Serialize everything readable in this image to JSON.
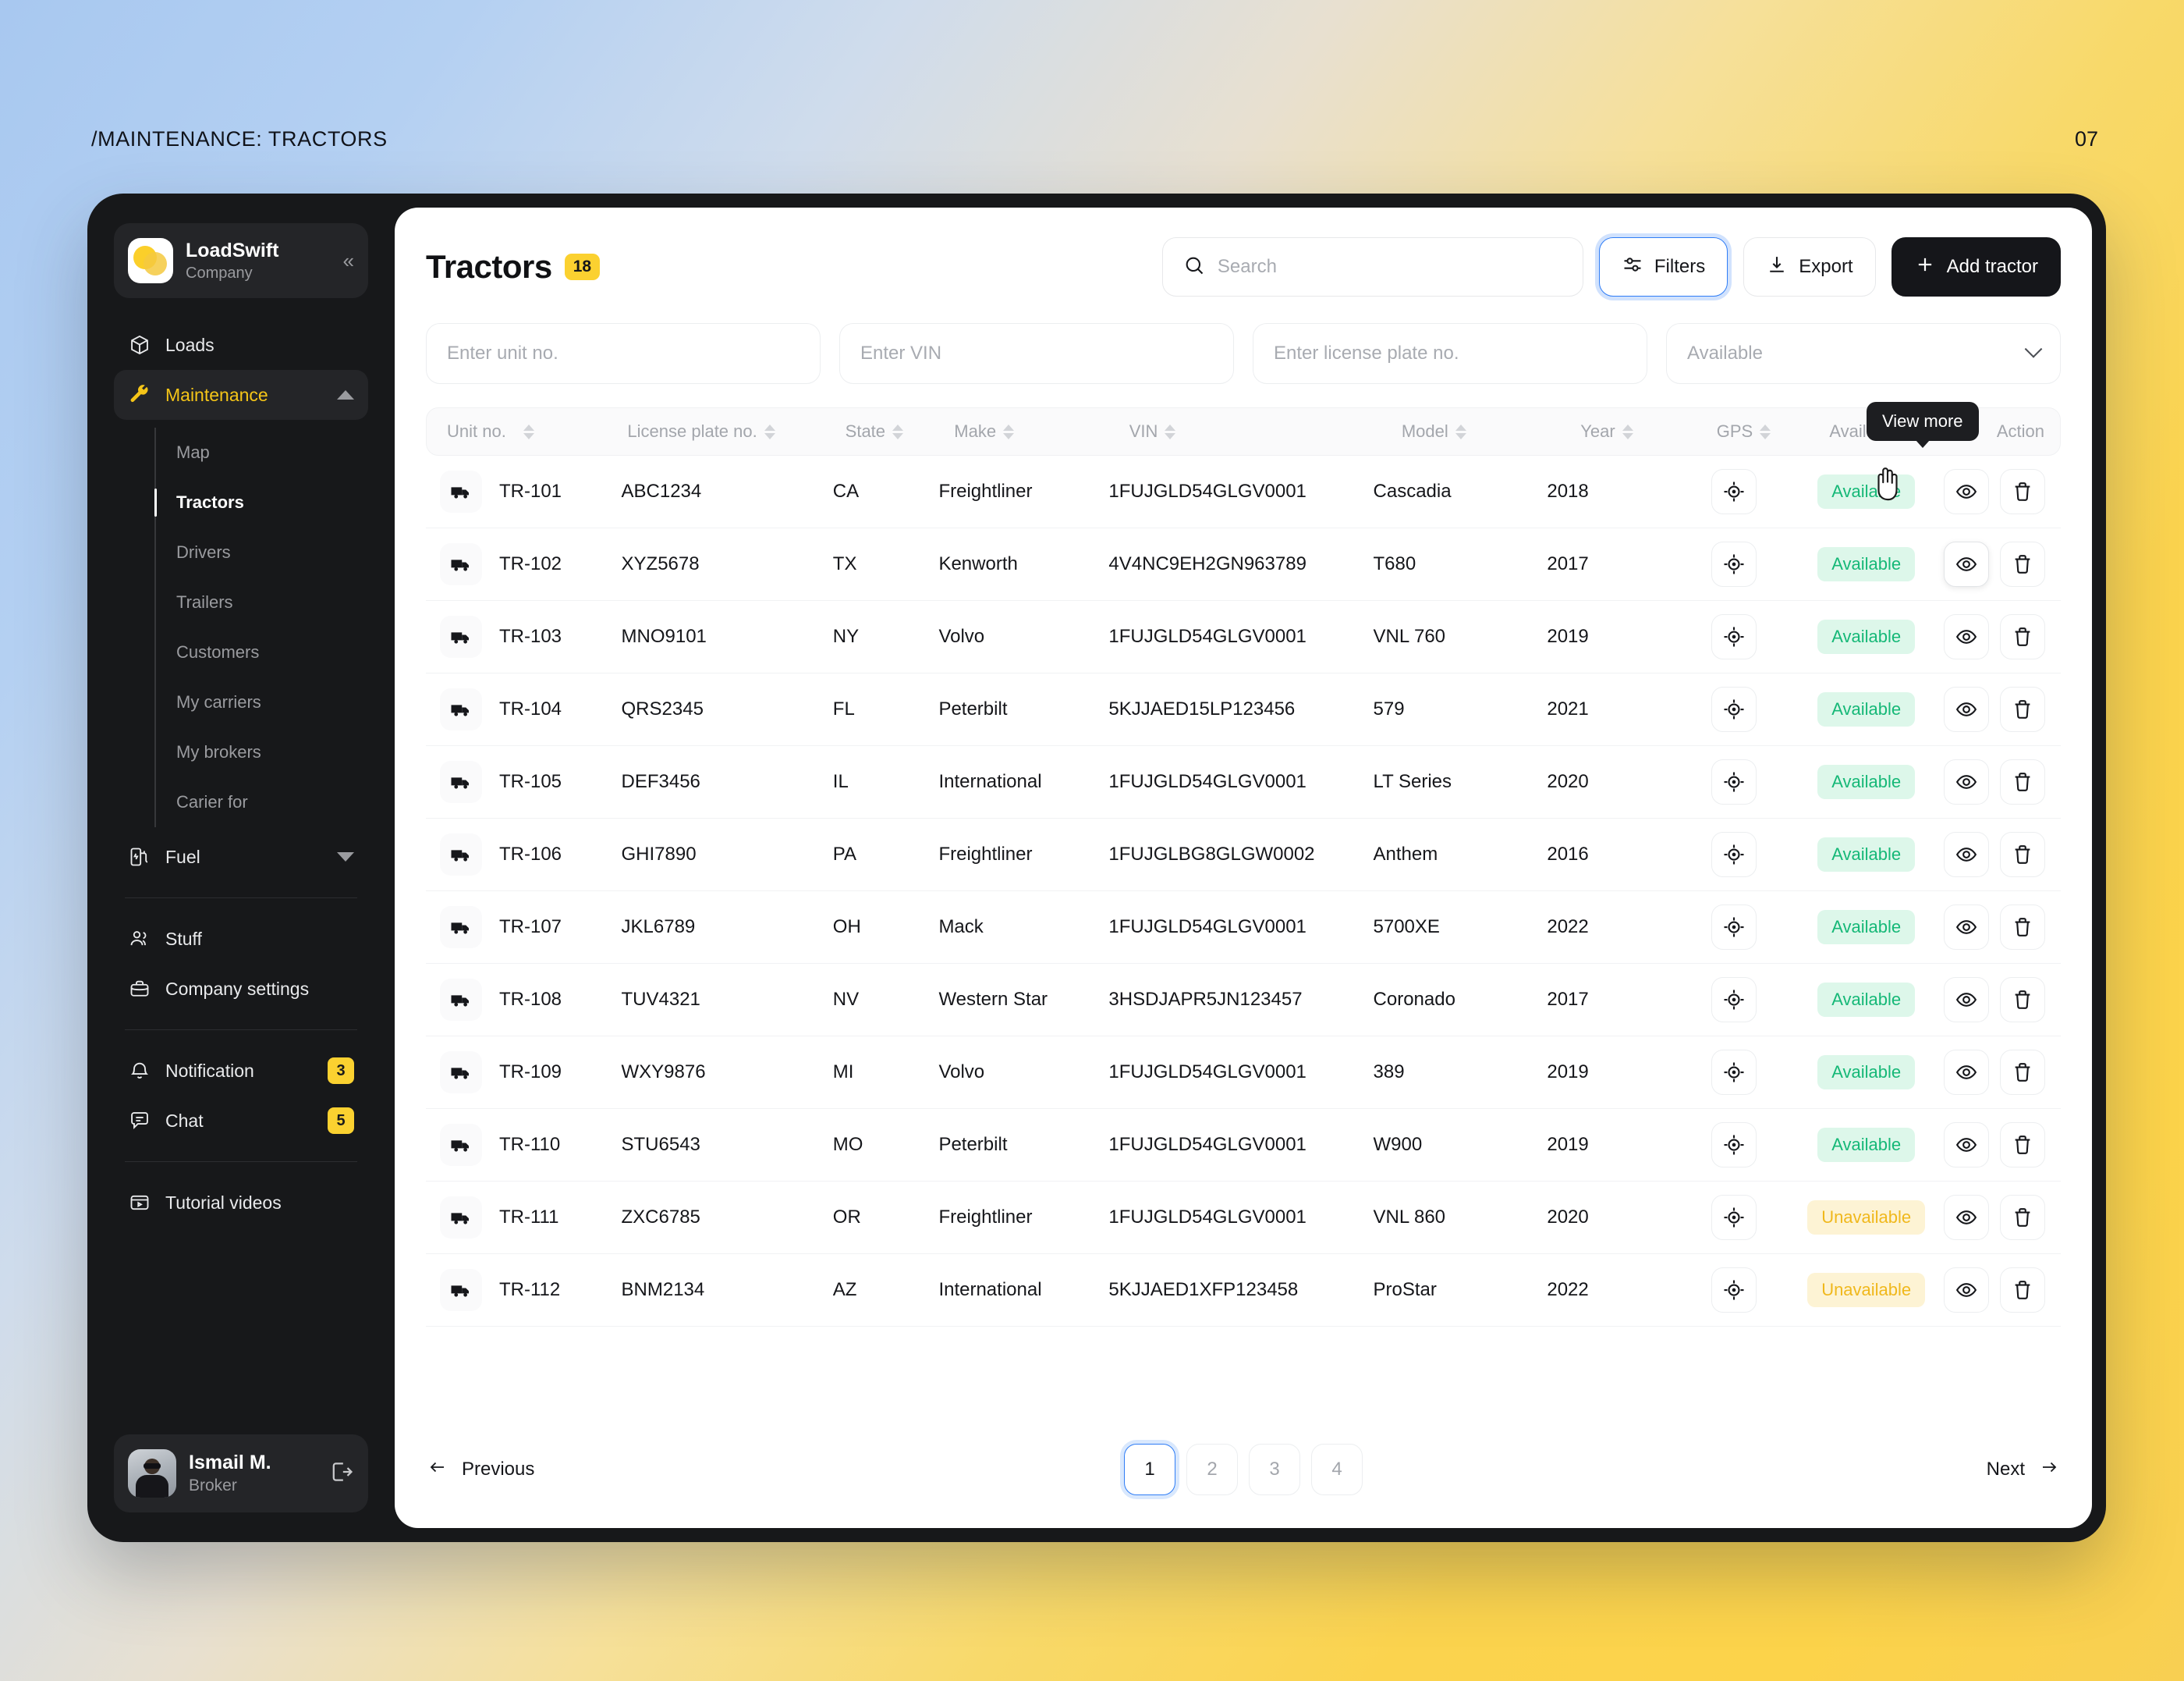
{
  "page": {
    "breadcrumb": "/MAINTENANCE: TRACTORS",
    "number": "07"
  },
  "sidebar": {
    "brand": {
      "name": "LoadSwift",
      "subtitle": "Company",
      "collapse_icon": "chevrons-left-icon"
    },
    "nav": [
      {
        "label": "Loads",
        "icon": "box-icon"
      },
      {
        "label": "Maintenance",
        "icon": "wrench-icon",
        "expanded": true
      }
    ],
    "subnav": [
      {
        "label": "Map"
      },
      {
        "label": "Tractors",
        "active": true
      },
      {
        "label": "Drivers"
      },
      {
        "label": "Trailers"
      },
      {
        "label": "Customers"
      },
      {
        "label": "My carriers"
      },
      {
        "label": "My brokers"
      },
      {
        "label": "Carier for"
      }
    ],
    "fuel": {
      "label": "Fuel",
      "icon": "fuel-pump-icon"
    },
    "group2": [
      {
        "label": "Stuff",
        "icon": "users-icon"
      },
      {
        "label": "Company settings",
        "icon": "briefcase-icon"
      }
    ],
    "group3": [
      {
        "label": "Notification",
        "icon": "bell-icon",
        "badge": "3"
      },
      {
        "label": "Chat",
        "icon": "chat-icon",
        "badge": "5"
      }
    ],
    "group4": [
      {
        "label": "Tutorial videos",
        "icon": "video-icon"
      }
    ],
    "user": {
      "name": "Ismail M.",
      "role": "Broker",
      "logout_icon": "logout-icon"
    }
  },
  "header": {
    "title": "Tractors",
    "count": "18",
    "search": {
      "placeholder": "Search",
      "value": "",
      "icon": "search-icon"
    },
    "filters_label": "Filters",
    "filters_icon": "sliders-icon",
    "export_label": "Export",
    "export_icon": "download-icon",
    "add_label": "Add tractor",
    "add_icon": "plus-icon"
  },
  "filters": {
    "unit_placeholder": "Enter unit no.",
    "vin_placeholder": "Enter VIN",
    "plate_placeholder": "Enter license plate no.",
    "status_value": "Available"
  },
  "table": {
    "columns": [
      "Unit no.",
      "License plate no.",
      "State",
      "Make",
      "VIN",
      "Model",
      "Year",
      "GPS",
      "Available",
      "Action"
    ],
    "tooltip": "View more",
    "rows": [
      {
        "unit": "TR-101",
        "plate": "ABC1234",
        "state": "CA",
        "make": "Freightliner",
        "vin": "1FUJGLD54GLGV0001",
        "model": "Cascadia",
        "year": "2018",
        "status": "Available"
      },
      {
        "unit": "TR-102",
        "plate": "XYZ5678",
        "state": "TX",
        "make": "Kenworth",
        "vin": "4V4NC9EH2GN963789",
        "model": "T680",
        "year": "2017",
        "status": "Available"
      },
      {
        "unit": "TR-103",
        "plate": "MNO9101",
        "state": "NY",
        "make": "Volvo",
        "vin": "1FUJGLD54GLGV0001",
        "model": "VNL 760",
        "year": "2019",
        "status": "Available"
      },
      {
        "unit": "TR-104",
        "plate": "QRS2345",
        "state": "FL",
        "make": "Peterbilt",
        "vin": "5KJJAED15LP123456",
        "model": "579",
        "year": "2021",
        "status": "Available"
      },
      {
        "unit": "TR-105",
        "plate": "DEF3456",
        "state": "IL",
        "make": "International",
        "vin": "1FUJGLD54GLGV0001",
        "model": "LT Series",
        "year": "2020",
        "status": "Available"
      },
      {
        "unit": "TR-106",
        "plate": "GHI7890",
        "state": "PA",
        "make": "Freightliner",
        "vin": "1FUJGLBG8GLGW0002",
        "model": "Anthem",
        "year": "2016",
        "status": "Available"
      },
      {
        "unit": "TR-107",
        "plate": "JKL6789",
        "state": "OH",
        "make": "Mack",
        "vin": "1FUJGLD54GLGV0001",
        "model": "5700XE",
        "year": "2022",
        "status": "Available"
      },
      {
        "unit": "TR-108",
        "plate": "TUV4321",
        "state": "NV",
        "make": "Western Star",
        "vin": "3HSDJAPR5JN123457",
        "model": "Coronado",
        "year": "2017",
        "status": "Available"
      },
      {
        "unit": "TR-109",
        "plate": "WXY9876",
        "state": "MI",
        "make": "Volvo",
        "vin": "1FUJGLD54GLGV0001",
        "model": "389",
        "year": "2019",
        "status": "Available"
      },
      {
        "unit": "TR-110",
        "plate": "STU6543",
        "state": "MO",
        "make": "Peterbilt",
        "vin": "1FUJGLD54GLGV0001",
        "model": "W900",
        "year": "2019",
        "status": "Available"
      },
      {
        "unit": "TR-111",
        "plate": "ZXC6785",
        "state": "OR",
        "make": "Freightliner",
        "vin": "1FUJGLD54GLGV0001",
        "model": "VNL 860",
        "year": "2020",
        "status": "Unavailable"
      },
      {
        "unit": "TR-112",
        "plate": "BNM2134",
        "state": "AZ",
        "make": "International",
        "vin": "5KJJAED1XFP123458",
        "model": "ProStar",
        "year": "2022",
        "status": "Unavailable"
      }
    ]
  },
  "pagination": {
    "previous": "Previous",
    "next": "Next",
    "pages": [
      "1",
      "2",
      "3",
      "4"
    ],
    "active": "1"
  },
  "colors": {
    "accent_yellow": "#FBD130",
    "focus_blue": "#2F7DF6",
    "available_text": "#15B877",
    "available_bg": "#DDF7EA",
    "unavailable_text": "#F0B81C",
    "unavailable_bg": "#FDF3D4",
    "dark": "#17181A"
  }
}
